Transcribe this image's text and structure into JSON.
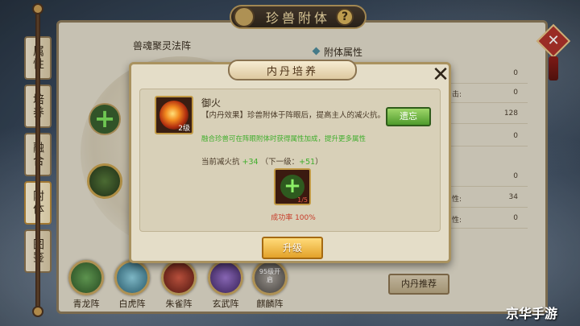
{
  "window": {
    "title": "珍兽附体"
  },
  "tabs": [
    {
      "label": "属性"
    },
    {
      "label": "培养"
    },
    {
      "label": "融合"
    },
    {
      "label": "附体"
    },
    {
      "label": "图鉴"
    }
  ],
  "left_panel": {
    "heading": "兽魂聚灵法阵"
  },
  "right_panel": {
    "heading": "附体属性",
    "rows": [
      {
        "label": "",
        "value": "0"
      },
      {
        "label": "击:",
        "value": "0"
      },
      {
        "label": "",
        "value": "128"
      },
      {
        "label": "",
        "value": "0"
      },
      {
        "label": "",
        "value": "0"
      },
      {
        "label": "性:",
        "value": "34"
      },
      {
        "label": "性:",
        "value": "0"
      }
    ],
    "recommend_button": "内丹推荐"
  },
  "formations": [
    {
      "label": "青龙阵",
      "color": "#3f7a3a"
    },
    {
      "label": "白虎阵",
      "color": "#4d8fa3"
    },
    {
      "label": "朱雀阵",
      "color": "#9a2d22"
    },
    {
      "label": "玄武阵",
      "color": "#5b3a8a"
    },
    {
      "label": "麒麟阵",
      "color": "#7a7570",
      "lock_text": "95级开启"
    }
  ],
  "modal": {
    "title": "内丹培养",
    "pill": {
      "name": "御火",
      "level": "2级",
      "effect": "【内丹效果】珍兽附体于阵眼后，提高主人的减火抗。",
      "green_note": "融合珍兽可在阵眼附体时获得属性加成，提升更多属性",
      "current_label": "当前减火抗",
      "current_value": "+34",
      "next_label": "（下一级：",
      "next_value": "+51",
      "next_close": "）"
    },
    "forget_button": "遗忘",
    "material_count": "1/5",
    "success_rate": "成功率 100%",
    "upgrade_button": "升级"
  },
  "watermark": "京华手游",
  "colors": {
    "accent": "#c7a560",
    "upgrade": "#e3a22a",
    "forget": "#4f9a2c"
  }
}
